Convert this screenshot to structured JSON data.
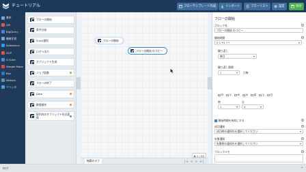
{
  "header": {
    "title": "チュートリアル",
    "buttons": [
      {
        "label": "フローテンプレート作成",
        "icon": "template-icon"
      },
      {
        "label": "インポート",
        "icon": "import-icon"
      },
      {
        "label": "フローリスト",
        "icon": "list-icon"
      },
      {
        "label": "設定",
        "icon": "gear-icon"
      },
      {
        "label": "保存",
        "icon": "save-icon"
      }
    ]
  },
  "sidebar": {
    "items": [
      {
        "label": "基本",
        "color": "#6aa9e0"
      },
      {
        "label": "API",
        "color": "#e05858"
      },
      {
        "label": "BigQuery",
        "color": "#4a84d8"
      },
      {
        "label": "機械学習",
        "color": "#7aa6d6"
      },
      {
        "label": "Salesforce",
        "color": "#34a0db"
      },
      {
        "label": "GCP",
        "color": "#e0583e"
      },
      {
        "label": "G Suite",
        "color": "#4a8ed8"
      },
      {
        "label": "Google Maps",
        "color": "#e04848"
      },
      {
        "label": "Box",
        "color": "#2f78cf"
      },
      {
        "label": "Watson",
        "color": "#6b8fb3"
      },
      {
        "label": "ツリッタ",
        "color": "#48a6e6"
      }
    ]
  },
  "blocks": {
    "items": [
      {
        "label": "フローの開始",
        "dot": ""
      },
      {
        "label": "条件分岐",
        "dot": ""
      },
      {
        "label": "Slack通知",
        "dot": ""
      },
      {
        "label": "ログへ出力",
        "dot": ""
      },
      {
        "label": "オブジェクト生成",
        "dot": ""
      },
      {
        "label": "ジョブ起動",
        "dot": "#e8894a"
      },
      {
        "label": "フローの終了",
        "dot": ""
      },
      {
        "label": "Date",
        "dot": "#e8894a"
      },
      {
        "label": "数値操作",
        "dot": "#e8894a"
      },
      {
        "label": "配列内のオブジェクト形式変換",
        "dot": "#4a8ed8"
      }
    ]
  },
  "canvas": {
    "nodes": [
      {
        "label": "フローの開始",
        "selected": false
      },
      {
        "label": "フローの開始 のコピー",
        "selected": true
      }
    ],
    "tab_label": "無題のタブ",
    "zoom_label": "0 / 60",
    "pager": "|< < > >|"
  },
  "props": {
    "title": "フローの開始",
    "block_name_label": "ブロック名",
    "block_name_value": "フローの開始 のコピー",
    "schedule_label": "開始時間",
    "schedule_value": "0 1 */1 * *",
    "repeat_label": "繰り返し",
    "repeat_value": "毎日",
    "interval_label": "繰り返し間隔",
    "interval_value": "1",
    "interval_unit": "日毎",
    "weekdays": [
      "月",
      "火",
      "水",
      "木",
      "金",
      "土",
      "日"
    ],
    "hour_label": "時",
    "hour_value": "1",
    "minute_label": "分",
    "minute_value": "0",
    "enabled_label": "開始時間を有効にする",
    "success_label": "成功通知",
    "success_value": "成功時の通知先を選択してください",
    "failure_label": "失敗通知",
    "failure_value": "失敗時の通知先を選択してください",
    "memo_label": "ブロックメモ"
  },
  "logbar": {
    "label": "ログ",
    "toggle": "^"
  },
  "colors": {
    "header_bg": "#1d3a5c",
    "sidebar_bg": "#223a5a",
    "save_button": "#4cae50",
    "accent": "#3f8fd6"
  }
}
